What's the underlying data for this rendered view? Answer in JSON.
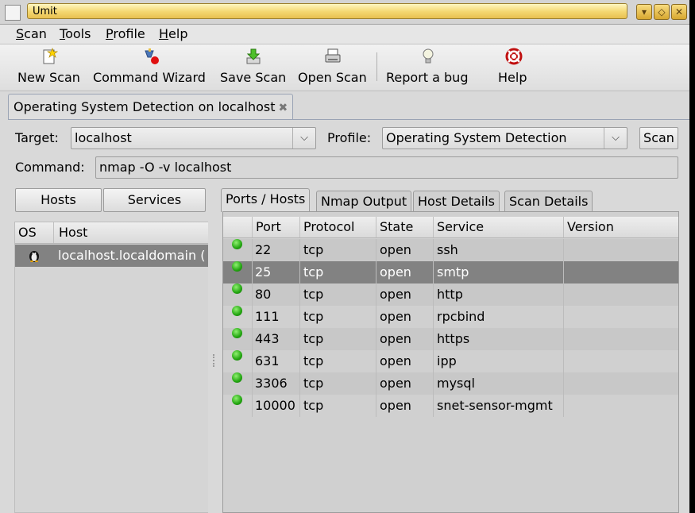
{
  "window": {
    "title": "Umit"
  },
  "menu": [
    "Scan",
    "Tools",
    "Profile",
    "Help"
  ],
  "toolbar": {
    "new_scan": "New Scan",
    "command_wizard": "Command Wizard",
    "save_scan": "Save Scan",
    "open_scan": "Open Scan",
    "report_bug": "Report a bug",
    "help": "Help"
  },
  "scan_tab": {
    "label": "Operating System Detection on localhost"
  },
  "form": {
    "target_label": "Target:",
    "target_value": "localhost",
    "profile_label": "Profile:",
    "profile_value": "Operating System Detection",
    "scan_button": "Scan",
    "command_label": "Command:",
    "command_value": "nmap -O -v localhost"
  },
  "left": {
    "hosts_button": "Hosts",
    "services_button": "Services",
    "columns": [
      "OS",
      "Host"
    ],
    "hosts": [
      {
        "host": "localhost.localdomain ("
      }
    ]
  },
  "result_tabs": [
    "Ports / Hosts",
    "Nmap Output",
    "Host Details",
    "Scan Details"
  ],
  "ports": {
    "columns": [
      "Port",
      "Protocol",
      "State",
      "Service",
      "Version"
    ],
    "rows": [
      {
        "port": "22",
        "protocol": "tcp",
        "state": "open",
        "service": "ssh",
        "version": ""
      },
      {
        "port": "25",
        "protocol": "tcp",
        "state": "open",
        "service": "smtp",
        "version": ""
      },
      {
        "port": "80",
        "protocol": "tcp",
        "state": "open",
        "service": "http",
        "version": ""
      },
      {
        "port": "111",
        "protocol": "tcp",
        "state": "open",
        "service": "rpcbind",
        "version": ""
      },
      {
        "port": "443",
        "protocol": "tcp",
        "state": "open",
        "service": "https",
        "version": ""
      },
      {
        "port": "631",
        "protocol": "tcp",
        "state": "open",
        "service": "ipp",
        "version": ""
      },
      {
        "port": "3306",
        "protocol": "tcp",
        "state": "open",
        "service": "mysql",
        "version": ""
      },
      {
        "port": "10000",
        "protocol": "tcp",
        "state": "open",
        "service": "snet-sensor-mgmt",
        "version": ""
      }
    ]
  },
  "icons": {
    "new_scan": "new-document-star-icon",
    "command_wizard": "wizard-icon",
    "save_scan": "save-download-icon",
    "open_scan": "printer-scanner-icon",
    "report_bug": "lightbulb-bug-icon",
    "help": "lifebuoy-icon",
    "port_state": "green-status-dot",
    "os": "linux-penguin-icon"
  },
  "colors": {
    "selection": "#828282",
    "title_bar": "#f4d770",
    "port_open": "#22a510"
  }
}
